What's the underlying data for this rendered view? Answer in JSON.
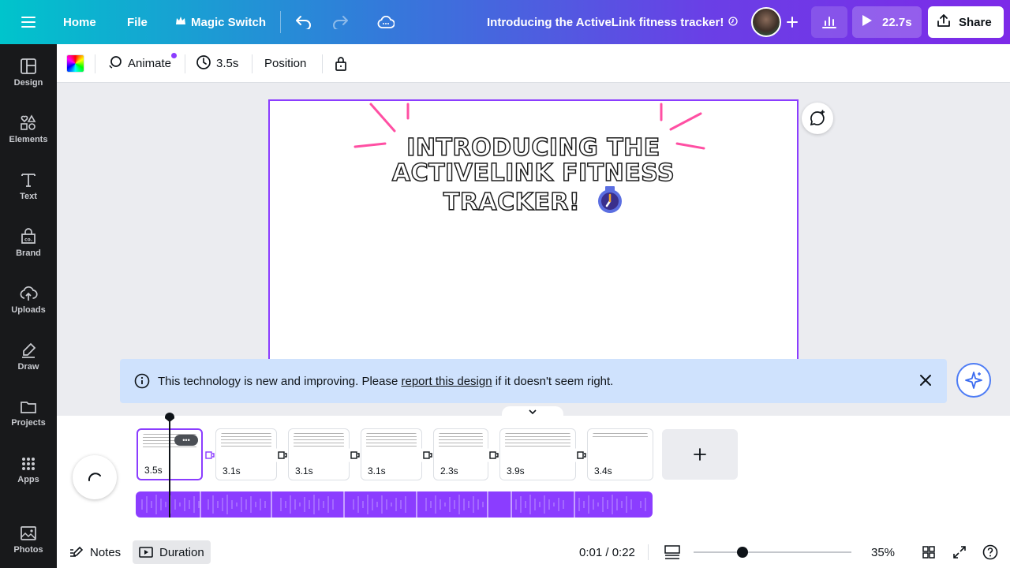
{
  "topbar": {
    "home_label": "Home",
    "file_label": "File",
    "magic_switch_label": "Magic Switch",
    "design_title": "Introducing the ActiveLink fitness tracker!",
    "play_duration": "22.7s",
    "share_label": "Share"
  },
  "sidebar": {
    "items": [
      {
        "label": "Design",
        "icon": "design-icon"
      },
      {
        "label": "Elements",
        "icon": "elements-icon"
      },
      {
        "label": "Text",
        "icon": "text-icon"
      },
      {
        "label": "Brand",
        "icon": "brand-icon"
      },
      {
        "label": "Uploads",
        "icon": "uploads-icon"
      },
      {
        "label": "Draw",
        "icon": "draw-icon"
      },
      {
        "label": "Projects",
        "icon": "folder-icon"
      },
      {
        "label": "Apps",
        "icon": "apps-icon"
      },
      {
        "label": "Photos",
        "icon": "photos-icon"
      }
    ]
  },
  "toolbar": {
    "animate_label": "Animate",
    "duration_label": "3.5s",
    "position_label": "Position"
  },
  "canvas": {
    "headline_line1": "INTRODUCING THE",
    "headline_line2": "ACTIVELINK FITNESS",
    "headline_line3": "TRACKER!",
    "accent_color": "#ff4fa3"
  },
  "notice": {
    "text_before": "This technology is new and improving. Please ",
    "link_text": "report this design",
    "text_after": " if it doesn't seem right."
  },
  "timeline": {
    "pages": [
      {
        "duration": "3.5s"
      },
      {
        "duration": "3.1s"
      },
      {
        "duration": "3.1s"
      },
      {
        "duration": "3.1s"
      },
      {
        "duration": "2.3s"
      },
      {
        "duration": "3.9s"
      },
      {
        "duration": "3.4s"
      }
    ],
    "more_label": "•••",
    "audio_color": "#8b3dff"
  },
  "footer": {
    "notes_label": "Notes",
    "duration_label": "Duration",
    "time_display": "0:01 / 0:22",
    "zoom_level": "35%",
    "zoom_fraction": 0.31
  },
  "colors": {
    "brand_purple": "#8b3dff",
    "sidebar_bg": "#18191b",
    "notice_bg": "#cfe2fd"
  }
}
